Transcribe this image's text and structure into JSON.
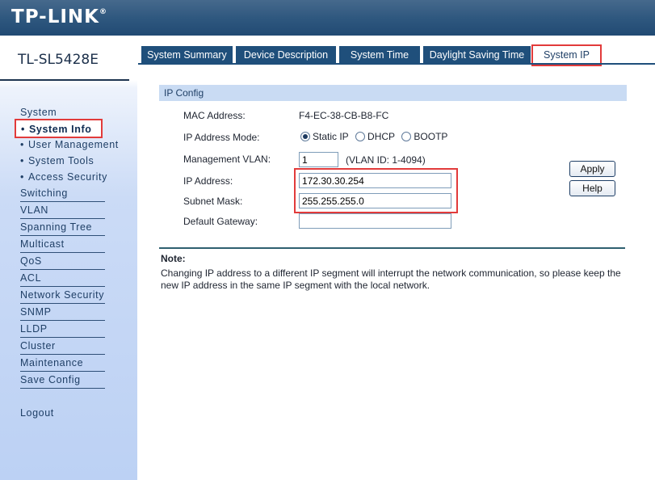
{
  "header": {
    "logo_text": "TP-LINK",
    "logo_mark": "®"
  },
  "sidebar": {
    "model": "TL-SL5428E",
    "system_label": "System",
    "system_items": [
      {
        "label": "System Info",
        "active": true
      },
      {
        "label": "User Management"
      },
      {
        "label": "System Tools"
      },
      {
        "label": "Access Security"
      }
    ],
    "items": [
      "Switching",
      "VLAN",
      "Spanning Tree",
      "Multicast",
      "QoS",
      "ACL",
      "Network Security",
      "SNMP",
      "LLDP",
      "Cluster",
      "Maintenance",
      "Save Config"
    ],
    "logout": "Logout",
    "bullet": "•"
  },
  "tabs": [
    {
      "label": "System Summary"
    },
    {
      "label": "Device Description"
    },
    {
      "label": "System Time"
    },
    {
      "label": "Daylight Saving Time"
    },
    {
      "label": "System IP",
      "active": true
    }
  ],
  "ip_config": {
    "title": "IP Config",
    "mac_label": "MAC Address:",
    "mac_value": "F4-EC-38-CB-B8-FC",
    "mode_label": "IP Address Mode:",
    "mode_options": [
      "Static IP",
      "DHCP",
      "BOOTP"
    ],
    "mode_selected": "Static IP",
    "vlan_label": "Management VLAN:",
    "vlan_value": "1",
    "vlan_hint": "(VLAN ID: 1-4094)",
    "ip_label": "IP Address:",
    "ip_value": "172.30.30.254",
    "mask_label": "Subnet Mask:",
    "mask_value": "255.255.255.0",
    "gateway_label": "Default Gateway:",
    "gateway_value": ""
  },
  "buttons": {
    "apply": "Apply",
    "help": "Help"
  },
  "note": {
    "title": "Note:",
    "text": "Changing IP address to a different IP segment will interrupt the network communication, so please keep the new IP address in the same IP segment with the local network."
  },
  "colors": {
    "header": "#2f587f",
    "tab": "#1f4f7b",
    "highlight": "#e23b3b",
    "section": "#c9dbf3"
  }
}
